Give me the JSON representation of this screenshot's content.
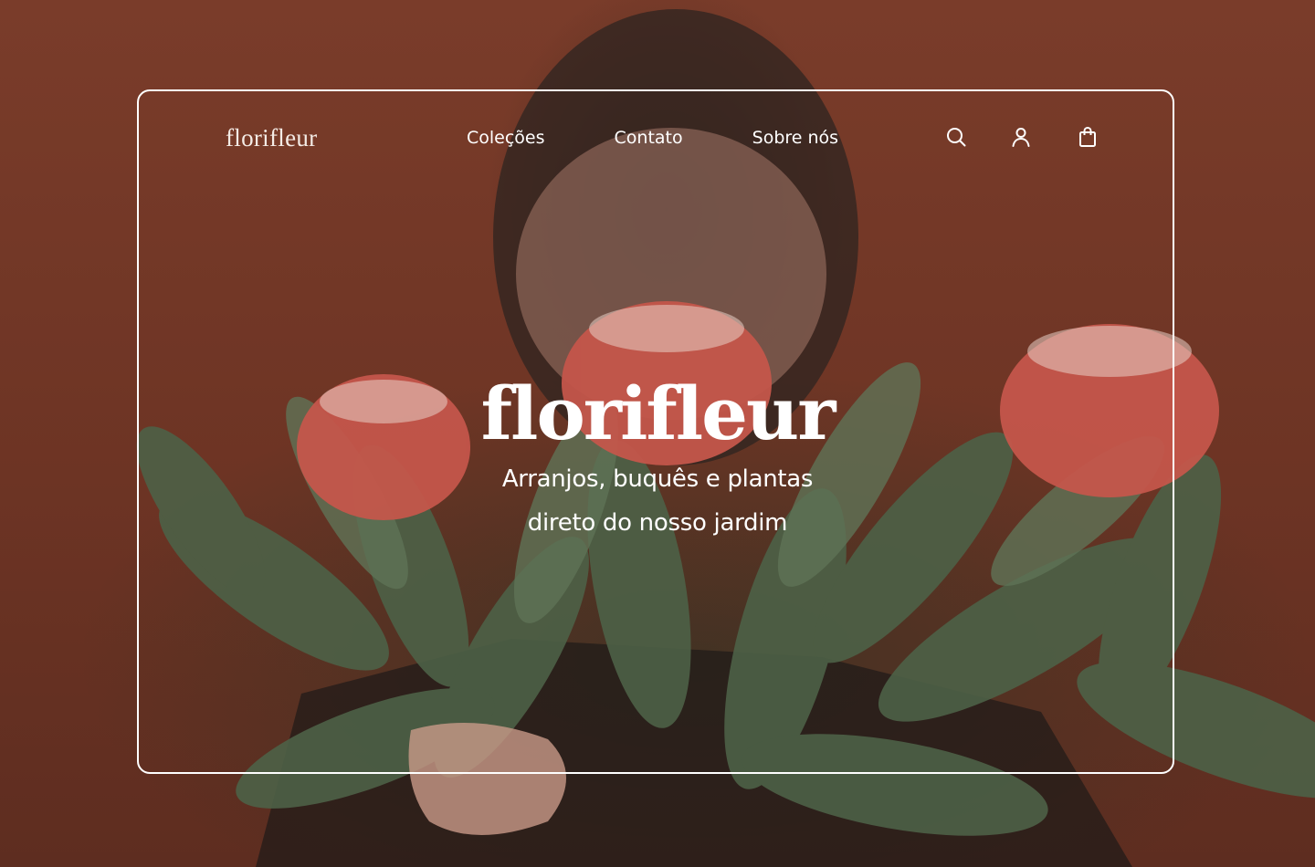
{
  "brand": {
    "name": "florifleur"
  },
  "nav": {
    "links": [
      "Coleções",
      "Contato",
      "Sobre nós"
    ],
    "icons": [
      "search-icon",
      "user-icon",
      "shopping-bag-icon"
    ]
  },
  "hero": {
    "title": "florifleur",
    "subtitle_line1": "Arranjos, buquês e plantas",
    "subtitle_line2": "direto do nosso jardim",
    "background_image": "person holding protea flower bouquet with green leaves"
  },
  "colors": {
    "background": "#6e3626",
    "foliage": "#4a5e44",
    "protea": "#c8584e",
    "text": "#ffffff",
    "frame_border": "#ffffff"
  }
}
